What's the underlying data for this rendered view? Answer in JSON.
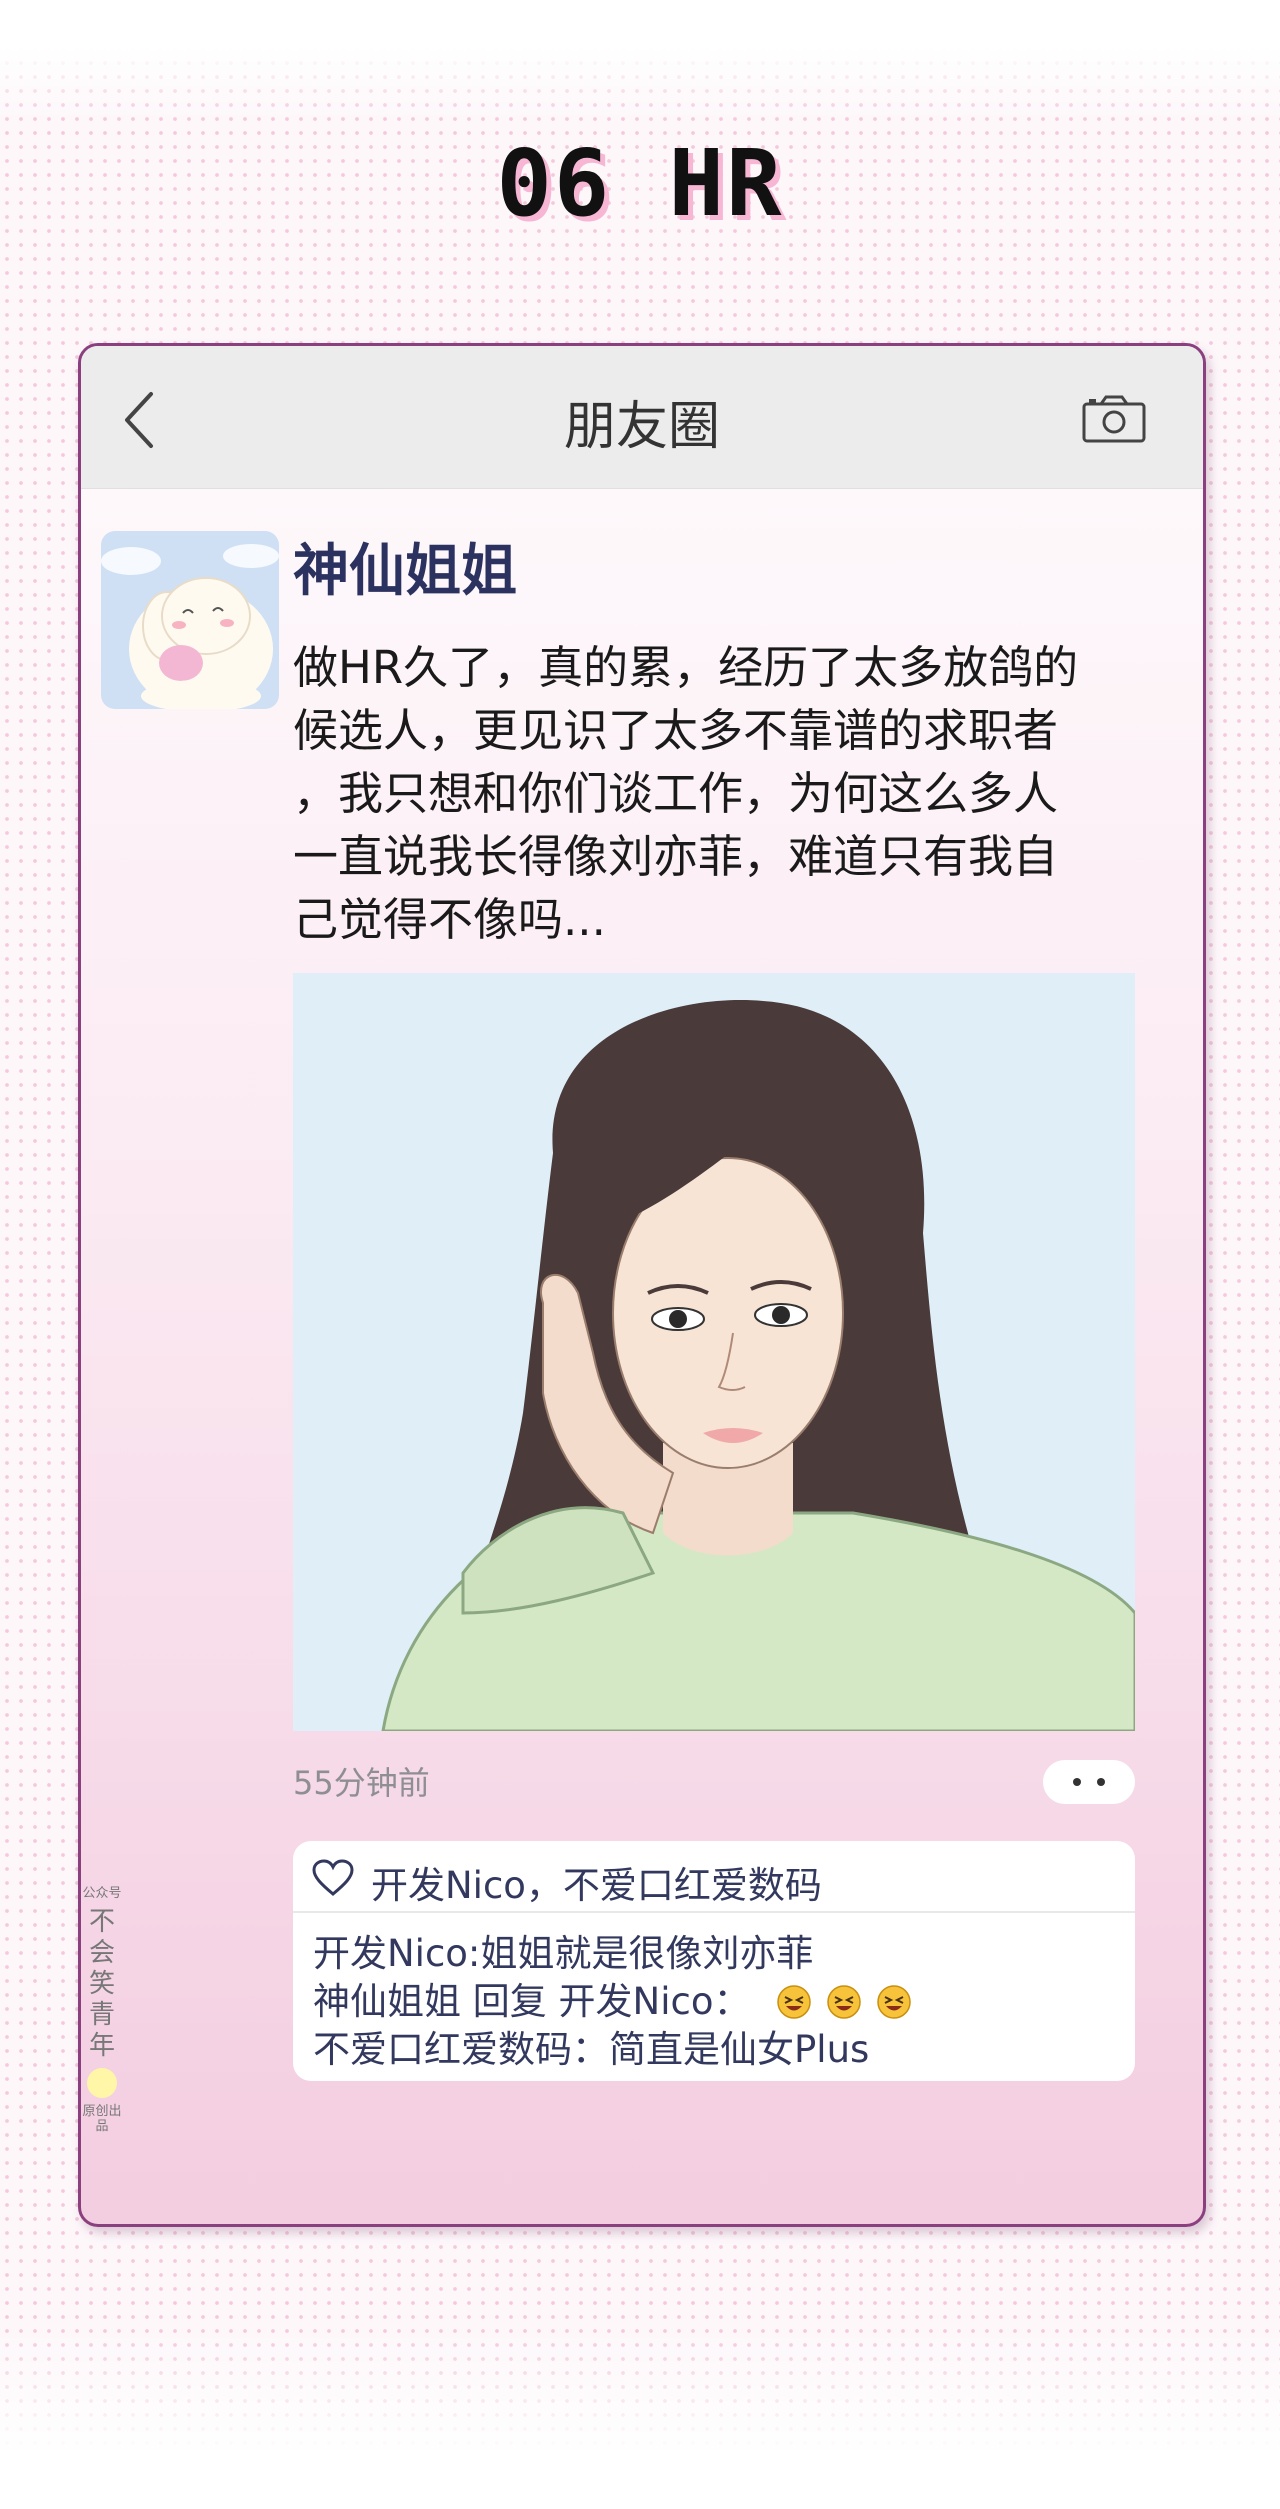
{
  "page_title": "06 HR",
  "nav": {
    "title": "朋友圈"
  },
  "post": {
    "username": "神仙姐姐",
    "text_lines": [
      "做HR久了，真的累，经历了太多放鸽的",
      "候选人，更见识了太多不靠谱的求职者",
      "，我只想和你们谈工作，为何这么多人",
      "一直说我长得像刘亦菲，难道只有我自",
      "己觉得不像吗..."
    ],
    "timestamp": "55分钟前"
  },
  "likes": {
    "names": "开发Nico，不爱口红爱数码"
  },
  "comments": [
    {
      "text": "开发Nico:姐姐就是很像刘亦菲"
    },
    {
      "text": "神仙姐姐 回复 开发Nico："
    },
    {
      "text": "不爱口红爱数码：简直是仙女Plus"
    }
  ],
  "watermark": {
    "label": "公众号",
    "name_chars": [
      "不",
      "会",
      "笑",
      "青",
      "年"
    ],
    "footer": "原创出品"
  },
  "colors": {
    "border": "#8a3f7e",
    "name": "#2c3260",
    "accent_shadow": "#f7b6d4"
  },
  "icons": [
    "back-arrow-icon",
    "camera-icon",
    "heart-icon",
    "grin-emoji-icon"
  ]
}
